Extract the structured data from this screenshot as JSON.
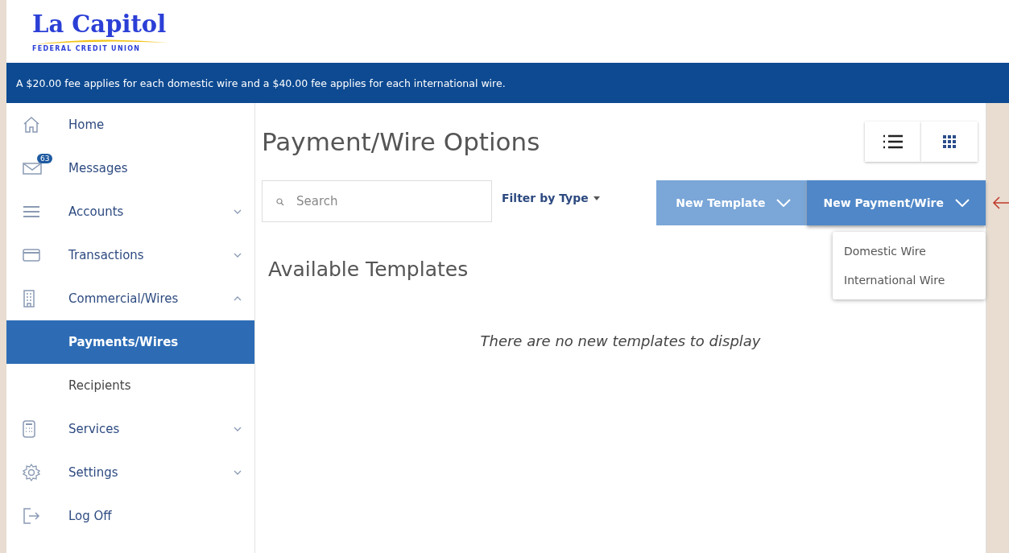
{
  "logo": {
    "name": "La Capitol",
    "tagline": "FEDERAL CREDIT UNION"
  },
  "banner": "A $20.00 fee applies for each domestic wire and a $40.00 fee applies for each international wire.",
  "sidebar": {
    "items": [
      {
        "label": "Home"
      },
      {
        "label": "Messages",
        "badge": "63"
      },
      {
        "label": "Accounts",
        "expanded": false
      },
      {
        "label": "Transactions",
        "expanded": false
      },
      {
        "label": "Commercial/Wires",
        "expanded": true,
        "children": [
          {
            "label": "Payments/Wires",
            "selected": true
          },
          {
            "label": "Recipients",
            "selected": false
          }
        ]
      },
      {
        "label": "Services",
        "expanded": false
      },
      {
        "label": "Settings",
        "expanded": false
      },
      {
        "label": "Log Off"
      }
    ]
  },
  "main": {
    "title": "Payment/Wire Options",
    "search": {
      "placeholder": "Search"
    },
    "filter": "Filter by Type",
    "buttons": [
      {
        "label": "New Template",
        "selected": false
      },
      {
        "label": "New Payment/Wire",
        "selected": true
      }
    ],
    "menu": [
      "Domestic Wire",
      "International Wire"
    ],
    "section_title": "Available Templates",
    "empty_message": "There are no new templates to display"
  }
}
